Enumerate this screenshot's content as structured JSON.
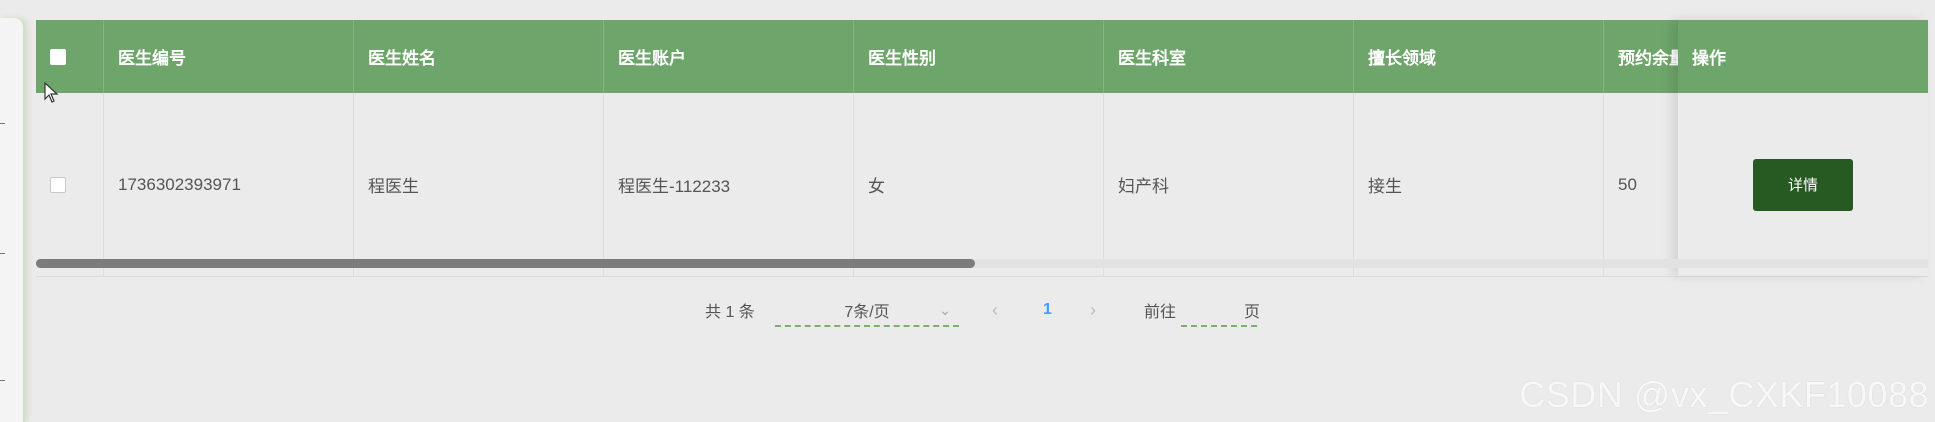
{
  "table": {
    "headers": [
      "医生编号",
      "医生姓名",
      "医生账户",
      "医生性别",
      "医生科室",
      "擅长领域",
      "预约余量"
    ],
    "action_header": "操作",
    "rows": [
      {
        "cells": [
          "1736302393971",
          "程医生",
          "程医生-112233",
          "女",
          "妇产科",
          "接生",
          "50"
        ],
        "action_label": "详情"
      }
    ]
  },
  "pagination": {
    "total": "共 1 条",
    "page_size": "7条/页",
    "current_page": "1",
    "goto_label": "前往",
    "page_suffix": "页"
  },
  "watermark": "CSDN @vx_CXKF10088",
  "colors": {
    "header_bg": "#6ea56a",
    "action_button": "#275a22",
    "active_page": "#409eff"
  }
}
